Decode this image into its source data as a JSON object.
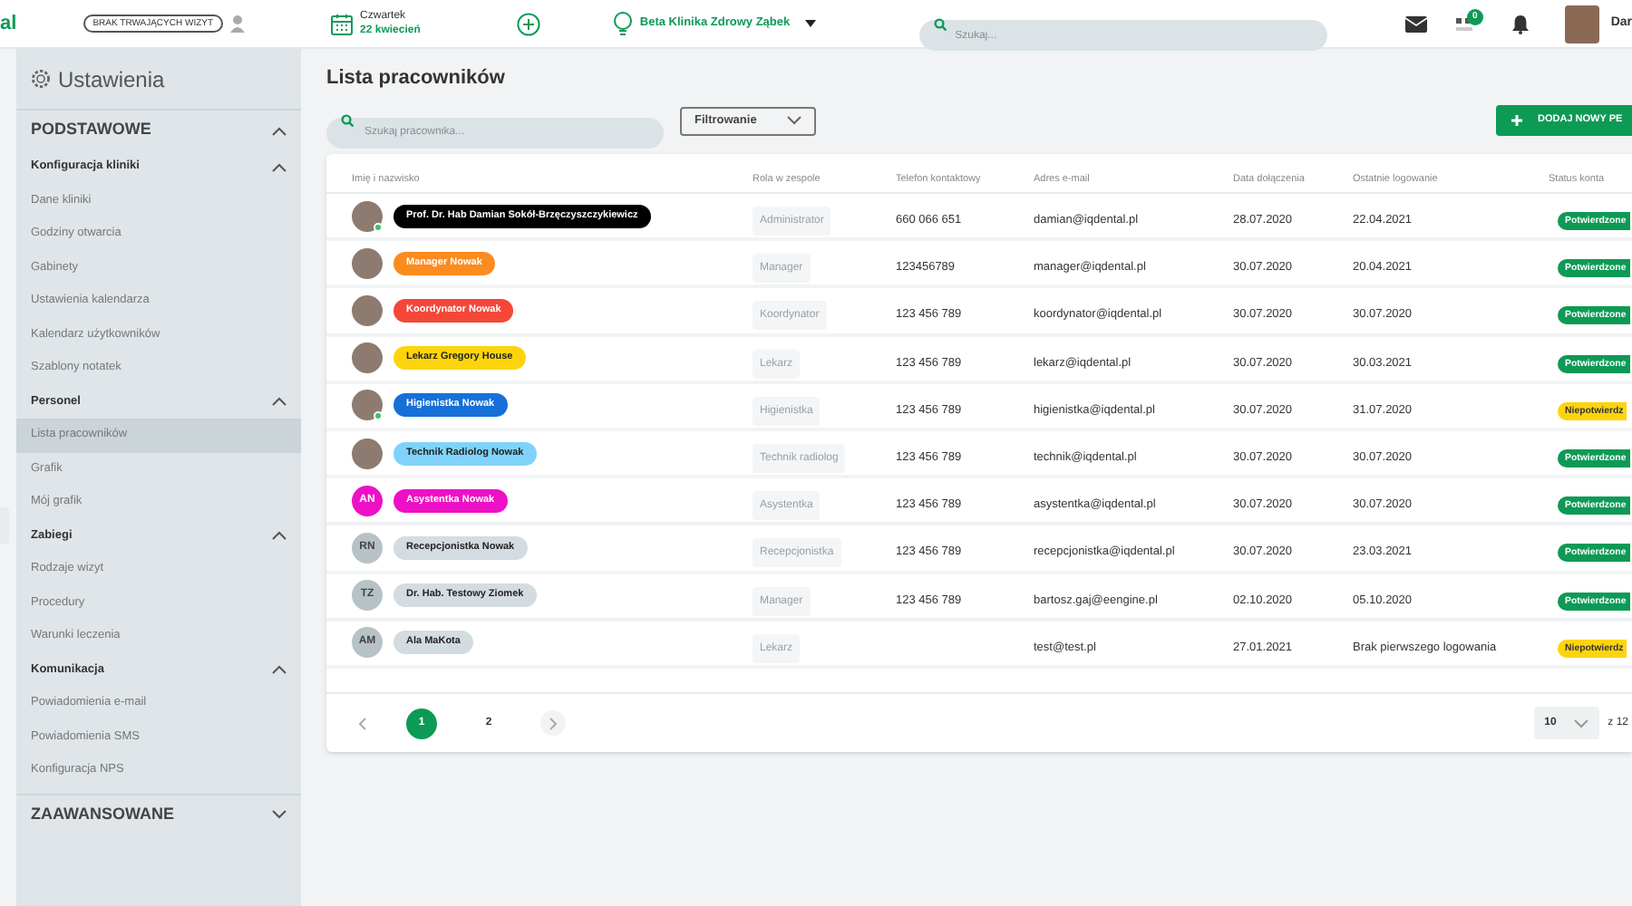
{
  "header": {
    "logo": "al",
    "visit_badge": "BRAK TRWAJĄCYCH WIZYT",
    "date_day": "Czwartek",
    "date": "22 kwiecień",
    "clinic": "Beta Klinika Zdrowy Ząbek",
    "search": {
      "placeholder": "Szukaj..."
    },
    "notification_count": "0",
    "user_name": "Dar"
  },
  "sidebar": {
    "title": "Ustawienia",
    "sections": [
      {
        "title": "PODSTAWOWE",
        "expanded": true,
        "groups": [
          {
            "title": "Konfiguracja kliniki",
            "expanded": true,
            "items": [
              {
                "label": "Dane kliniki",
                "selected": false
              },
              {
                "label": "Godziny otwarcia",
                "selected": false
              },
              {
                "label": "Gabinety",
                "selected": false
              },
              {
                "label": "Ustawienia kalendarza",
                "selected": false
              },
              {
                "label": "Kalendarz użytkowników",
                "selected": false
              },
              {
                "label": "Szablony notatek",
                "selected": false
              }
            ]
          },
          {
            "title": "Personel",
            "expanded": true,
            "items": [
              {
                "label": "Lista pracowników",
                "selected": true
              },
              {
                "label": "Grafik",
                "selected": false
              },
              {
                "label": "Mój grafik",
                "selected": false
              }
            ]
          },
          {
            "title": "Zabiegi",
            "expanded": true,
            "items": [
              {
                "label": "Rodzaje wizyt",
                "selected": false
              },
              {
                "label": "Procedury",
                "selected": false
              },
              {
                "label": "Warunki leczenia",
                "selected": false
              }
            ]
          },
          {
            "title": "Komunikacja",
            "expanded": true,
            "items": [
              {
                "label": "Powiadomienia e-mail",
                "selected": false
              },
              {
                "label": "Powiadomienia SMS",
                "selected": false
              },
              {
                "label": "Konfiguracja NPS",
                "selected": false
              }
            ]
          }
        ]
      },
      {
        "title": "ZAAWANSOWANE",
        "expanded": false
      }
    ]
  },
  "page": {
    "title": "Lista pracowników",
    "search": {
      "placeholder": "Szukaj pracownika..."
    },
    "filter": "Filtrowanie",
    "add_button": "DODAJ NOWY PE"
  },
  "table": {
    "columns": [
      "Imię i nazwisko",
      "Rola w zespole",
      "Telefon kontaktowy",
      "Adres e-mail",
      "Data dołączenia",
      "Ostatnie logowanie",
      "Status konta"
    ],
    "rows": [
      {
        "avatar": {
          "kind": "photo",
          "online": true
        },
        "name": "Prof. Dr. Hab Damian Sokół-Brzęczyszczykiewicz",
        "color": "#000000",
        "role": "Administrator",
        "phone": "660 066 651",
        "email": "damian@iqdental.pl",
        "joined": "28.07.2020",
        "last_login": "22.04.2021",
        "status": {
          "kind": "confirmed",
          "label": "Potwierdzone"
        }
      },
      {
        "avatar": {
          "kind": "photo",
          "online": false
        },
        "name": "Manager Nowak",
        "color": "#fb8c1f",
        "role": "Manager",
        "phone": "123456789",
        "email": "manager@iqdental.pl",
        "joined": "30.07.2020",
        "last_login": "20.04.2021",
        "status": {
          "kind": "confirmed",
          "label": "Potwierdzone"
        }
      },
      {
        "avatar": {
          "kind": "photo",
          "online": false
        },
        "name": "Koordynator Nowak",
        "color": "#f4473a",
        "role": "Koordynator",
        "phone": "123 456 789",
        "email": "koordynator@iqdental.pl",
        "joined": "30.07.2020",
        "last_login": "30.07.2020",
        "status": {
          "kind": "confirmed",
          "label": "Potwierdzone"
        }
      },
      {
        "avatar": {
          "kind": "photo",
          "online": false
        },
        "name": "Lekarz Gregory House",
        "color": "#fdd40c",
        "role": "Lekarz",
        "phone": "123 456 789",
        "email": "lekarz@iqdental.pl",
        "joined": "30.07.2020",
        "last_login": "30.03.2021",
        "status": {
          "kind": "confirmed",
          "label": "Potwierdzone"
        }
      },
      {
        "avatar": {
          "kind": "photo",
          "online": true
        },
        "name": "Higienistka Nowak",
        "color": "#1670d8",
        "role": "Higienistka",
        "phone": "123 456 789",
        "email": "higienistka@iqdental.pl",
        "joined": "30.07.2020",
        "last_login": "31.07.2020",
        "status": {
          "kind": "unconfirmed",
          "label": "Niepotwierdz"
        }
      },
      {
        "avatar": {
          "kind": "photo",
          "online": false
        },
        "name": "Technik Radiolog Nowak",
        "color": "#7fd3fb",
        "role": "Technik radiolog",
        "phone": "123 456 789",
        "email": "technik@iqdental.pl",
        "joined": "30.07.2020",
        "last_login": "30.07.2020",
        "status": {
          "kind": "confirmed",
          "label": "Potwierdzone"
        }
      },
      {
        "avatar": {
          "kind": "initials",
          "online": false,
          "initials": "AN"
        },
        "name": "Asystentka Nowak",
        "color": "#ee10c6",
        "role": "Asystentka",
        "phone": "123 456 789",
        "email": "asystentka@iqdental.pl",
        "joined": "30.07.2020",
        "last_login": "30.07.2020",
        "status": {
          "kind": "confirmed",
          "label": "Potwierdzone"
        }
      },
      {
        "avatar": {
          "kind": "initials",
          "online": false,
          "initials": "RN"
        },
        "name": "Recepcjonistka Nowak",
        "color": "#d3dce0",
        "role": "Recepcjonistka",
        "phone": "123 456 789",
        "email": "recepcjonistka@iqdental.pl",
        "joined": "30.07.2020",
        "last_login": "23.03.2021",
        "status": {
          "kind": "confirmed",
          "label": "Potwierdzone"
        }
      },
      {
        "avatar": {
          "kind": "initials",
          "online": false,
          "initials": "TZ"
        },
        "name": "Dr. Hab. Testowy Ziomek",
        "color": "#d3dce0",
        "role": "Manager",
        "phone": "123 456 789",
        "email": "bartosz.gaj@eengine.pl",
        "joined": "02.10.2020",
        "last_login": "05.10.2020",
        "status": {
          "kind": "confirmed",
          "label": "Potwierdzone"
        }
      },
      {
        "avatar": {
          "kind": "initials",
          "online": false,
          "initials": "AM"
        },
        "name": "Ala MaKota",
        "color": "#d3dce0",
        "role": "Lekarz",
        "email": "test@test.pl",
        "joined": "27.01.2021",
        "last_login": "Brak pierwszego logowania",
        "status": {
          "kind": "unconfirmed",
          "label": "Niepotwierdz"
        }
      }
    ]
  },
  "pagination": {
    "pages": [
      {
        "label": "1",
        "selected": true
      },
      {
        "label": "2",
        "selected": false
      }
    ],
    "per_page": "10",
    "total": "z 12"
  }
}
